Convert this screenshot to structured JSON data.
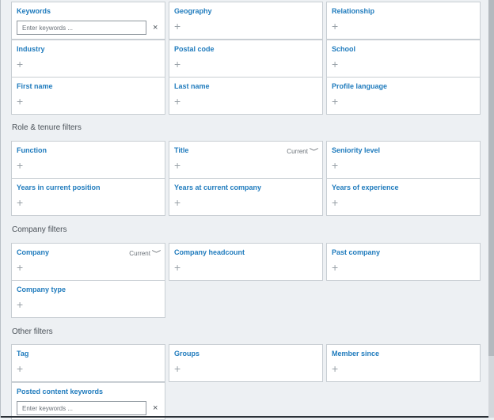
{
  "sections": {
    "role": "Role & tenure filters",
    "company": "Company filters",
    "other": "Other filters"
  },
  "filters": {
    "keywords": {
      "label": "Keywords",
      "placeholder": "Enter keywords ..."
    },
    "geography": "Geography",
    "relationship": "Relationship",
    "industry": "Industry",
    "postal_code": "Postal code",
    "school": "School",
    "first_name": "First name",
    "last_name": "Last name",
    "profile_language": "Profile language",
    "function": "Function",
    "title": {
      "label": "Title",
      "mode": "Current"
    },
    "seniority_level": "Seniority level",
    "years_in_position": "Years in current position",
    "years_at_company": "Years at current company",
    "years_experience": "Years of experience",
    "company": {
      "label": "Company",
      "mode": "Current"
    },
    "company_headcount": "Company headcount",
    "past_company": "Past company",
    "company_type": "Company type",
    "tag": "Tag",
    "groups": "Groups",
    "member_since": "Member since",
    "posted_content_keywords": {
      "label": "Posted content keywords",
      "placeholder": "Enter keywords ..."
    }
  },
  "icons": {
    "add": "+",
    "clear": "×",
    "chevron": "﹀"
  },
  "colors": {
    "accent": "#1f7bbd",
    "background": "#edf0f3"
  }
}
